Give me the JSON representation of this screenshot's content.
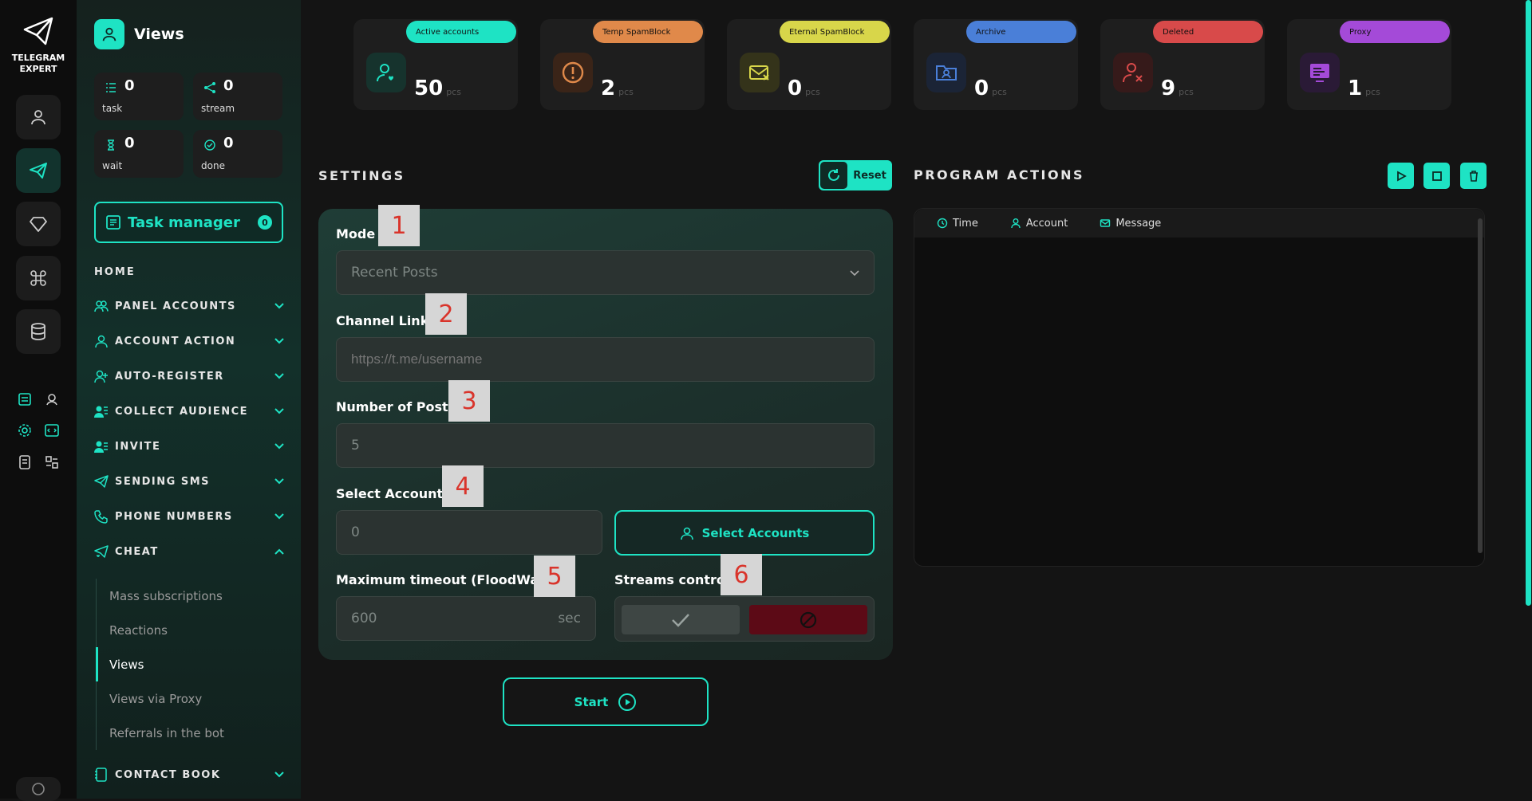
{
  "brand": {
    "line1": "TELEGRAM",
    "line2": "EXPERT"
  },
  "colors": {
    "accent": "#1ee3c4",
    "active_accounts": "#1ee3c4",
    "temp_spam": "#e0894a",
    "eternal_spam": "#d8d64a",
    "archive": "#4a7fd8",
    "deleted": "#d84a4a",
    "proxy": "#a44ad8"
  },
  "sidebar": {
    "title": "Views",
    "stats": [
      {
        "value": "0",
        "label": "task",
        "icon": "list-check-icon"
      },
      {
        "value": "0",
        "label": "stream",
        "icon": "share-nodes-icon"
      },
      {
        "value": "0",
        "label": "wait",
        "icon": "hourglass-icon"
      },
      {
        "value": "0",
        "label": "done",
        "icon": "check-circle-icon"
      }
    ],
    "task_manager": {
      "label": "Task manager",
      "badge": "0"
    },
    "home": "HOME",
    "nav": [
      {
        "label": "PANEL ACCOUNTS",
        "icon": "users-icon",
        "expanded": false
      },
      {
        "label": "ACCOUNT ACTION",
        "icon": "user-icon",
        "expanded": false
      },
      {
        "label": "AUTO-REGISTER",
        "icon": "user-plus-icon",
        "expanded": false
      },
      {
        "label": "COLLECT AUDIENCE",
        "icon": "user-group-icon",
        "expanded": false
      },
      {
        "label": "INVITE",
        "icon": "user-invite-icon",
        "expanded": false
      },
      {
        "label": "SENDING SMS",
        "icon": "paper-plane-icon",
        "expanded": false
      },
      {
        "label": "PHONE NUMBERS",
        "icon": "phone-icon",
        "expanded": false
      },
      {
        "label": "CHEAT",
        "icon": "send-heart-icon",
        "expanded": true
      }
    ],
    "cheat_items": [
      "Mass subscriptions",
      "Reactions",
      "Views",
      "Views via Proxy",
      "Referrals in the bot"
    ],
    "active_cheat_item": "Views",
    "contact_book": "CONTACT BOOK"
  },
  "cards": [
    {
      "label": "Active accounts",
      "value": "50",
      "unit": "pcs"
    },
    {
      "label": "Temp SpamBlock",
      "value": "2",
      "unit": "pcs"
    },
    {
      "label": "Eternal SpamBlock",
      "value": "0",
      "unit": "pcs"
    },
    {
      "label": "Archive",
      "value": "0",
      "unit": "pcs"
    },
    {
      "label": "Deleted",
      "value": "9",
      "unit": "pcs"
    },
    {
      "label": "Proxy",
      "value": "1",
      "unit": "pcs"
    }
  ],
  "settings": {
    "title": "SETTINGS",
    "reset_label": "Reset",
    "mode": {
      "label": "Mode",
      "value": "Recent Posts"
    },
    "channel_link": {
      "label": "Channel Link",
      "placeholder": "https://t.me/username"
    },
    "num_posts": {
      "label": "Number of Posts",
      "value": "5"
    },
    "select_accounts": {
      "label": "Select Accounts",
      "value": "0",
      "button": "Select Accounts"
    },
    "max_timeout": {
      "label": "Maximum timeout (FloodWait)",
      "value": "600",
      "unit": "sec"
    },
    "streams": {
      "label": "Streams control"
    },
    "start_label": "Start"
  },
  "markers": [
    "1",
    "2",
    "3",
    "4",
    "5",
    "6"
  ],
  "actions": {
    "title": "PROGRAM ACTIONS",
    "columns": [
      "Time",
      "Account",
      "Message"
    ]
  }
}
